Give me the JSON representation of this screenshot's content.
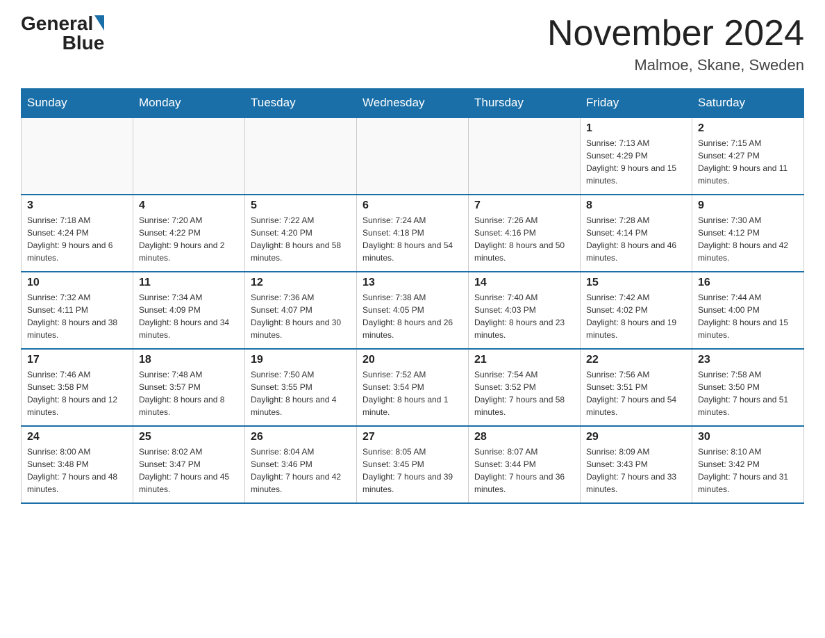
{
  "header": {
    "logo_text_general": "General",
    "logo_text_blue": "Blue",
    "month_title": "November 2024",
    "location": "Malmoe, Skane, Sweden"
  },
  "calendar": {
    "days_of_week": [
      "Sunday",
      "Monday",
      "Tuesday",
      "Wednesday",
      "Thursday",
      "Friday",
      "Saturday"
    ],
    "weeks": [
      [
        {
          "day": "",
          "info": ""
        },
        {
          "day": "",
          "info": ""
        },
        {
          "day": "",
          "info": ""
        },
        {
          "day": "",
          "info": ""
        },
        {
          "day": "",
          "info": ""
        },
        {
          "day": "1",
          "info": "Sunrise: 7:13 AM\nSunset: 4:29 PM\nDaylight: 9 hours and 15 minutes."
        },
        {
          "day": "2",
          "info": "Sunrise: 7:15 AM\nSunset: 4:27 PM\nDaylight: 9 hours and 11 minutes."
        }
      ],
      [
        {
          "day": "3",
          "info": "Sunrise: 7:18 AM\nSunset: 4:24 PM\nDaylight: 9 hours and 6 minutes."
        },
        {
          "day": "4",
          "info": "Sunrise: 7:20 AM\nSunset: 4:22 PM\nDaylight: 9 hours and 2 minutes."
        },
        {
          "day": "5",
          "info": "Sunrise: 7:22 AM\nSunset: 4:20 PM\nDaylight: 8 hours and 58 minutes."
        },
        {
          "day": "6",
          "info": "Sunrise: 7:24 AM\nSunset: 4:18 PM\nDaylight: 8 hours and 54 minutes."
        },
        {
          "day": "7",
          "info": "Sunrise: 7:26 AM\nSunset: 4:16 PM\nDaylight: 8 hours and 50 minutes."
        },
        {
          "day": "8",
          "info": "Sunrise: 7:28 AM\nSunset: 4:14 PM\nDaylight: 8 hours and 46 minutes."
        },
        {
          "day": "9",
          "info": "Sunrise: 7:30 AM\nSunset: 4:12 PM\nDaylight: 8 hours and 42 minutes."
        }
      ],
      [
        {
          "day": "10",
          "info": "Sunrise: 7:32 AM\nSunset: 4:11 PM\nDaylight: 8 hours and 38 minutes."
        },
        {
          "day": "11",
          "info": "Sunrise: 7:34 AM\nSunset: 4:09 PM\nDaylight: 8 hours and 34 minutes."
        },
        {
          "day": "12",
          "info": "Sunrise: 7:36 AM\nSunset: 4:07 PM\nDaylight: 8 hours and 30 minutes."
        },
        {
          "day": "13",
          "info": "Sunrise: 7:38 AM\nSunset: 4:05 PM\nDaylight: 8 hours and 26 minutes."
        },
        {
          "day": "14",
          "info": "Sunrise: 7:40 AM\nSunset: 4:03 PM\nDaylight: 8 hours and 23 minutes."
        },
        {
          "day": "15",
          "info": "Sunrise: 7:42 AM\nSunset: 4:02 PM\nDaylight: 8 hours and 19 minutes."
        },
        {
          "day": "16",
          "info": "Sunrise: 7:44 AM\nSunset: 4:00 PM\nDaylight: 8 hours and 15 minutes."
        }
      ],
      [
        {
          "day": "17",
          "info": "Sunrise: 7:46 AM\nSunset: 3:58 PM\nDaylight: 8 hours and 12 minutes."
        },
        {
          "day": "18",
          "info": "Sunrise: 7:48 AM\nSunset: 3:57 PM\nDaylight: 8 hours and 8 minutes."
        },
        {
          "day": "19",
          "info": "Sunrise: 7:50 AM\nSunset: 3:55 PM\nDaylight: 8 hours and 4 minutes."
        },
        {
          "day": "20",
          "info": "Sunrise: 7:52 AM\nSunset: 3:54 PM\nDaylight: 8 hours and 1 minute."
        },
        {
          "day": "21",
          "info": "Sunrise: 7:54 AM\nSunset: 3:52 PM\nDaylight: 7 hours and 58 minutes."
        },
        {
          "day": "22",
          "info": "Sunrise: 7:56 AM\nSunset: 3:51 PM\nDaylight: 7 hours and 54 minutes."
        },
        {
          "day": "23",
          "info": "Sunrise: 7:58 AM\nSunset: 3:50 PM\nDaylight: 7 hours and 51 minutes."
        }
      ],
      [
        {
          "day": "24",
          "info": "Sunrise: 8:00 AM\nSunset: 3:48 PM\nDaylight: 7 hours and 48 minutes."
        },
        {
          "day": "25",
          "info": "Sunrise: 8:02 AM\nSunset: 3:47 PM\nDaylight: 7 hours and 45 minutes."
        },
        {
          "day": "26",
          "info": "Sunrise: 8:04 AM\nSunset: 3:46 PM\nDaylight: 7 hours and 42 minutes."
        },
        {
          "day": "27",
          "info": "Sunrise: 8:05 AM\nSunset: 3:45 PM\nDaylight: 7 hours and 39 minutes."
        },
        {
          "day": "28",
          "info": "Sunrise: 8:07 AM\nSunset: 3:44 PM\nDaylight: 7 hours and 36 minutes."
        },
        {
          "day": "29",
          "info": "Sunrise: 8:09 AM\nSunset: 3:43 PM\nDaylight: 7 hours and 33 minutes."
        },
        {
          "day": "30",
          "info": "Sunrise: 8:10 AM\nSunset: 3:42 PM\nDaylight: 7 hours and 31 minutes."
        }
      ]
    ]
  }
}
